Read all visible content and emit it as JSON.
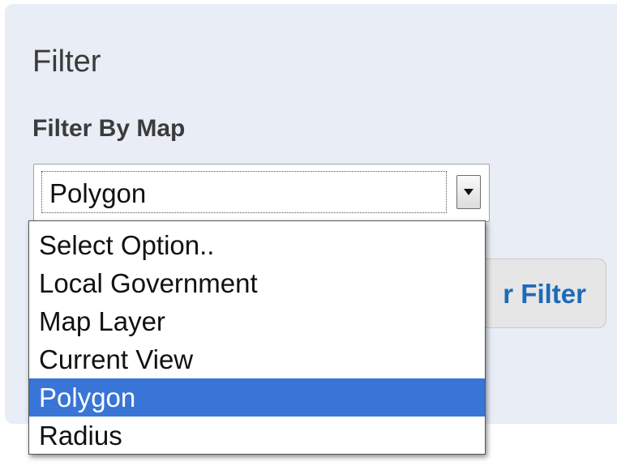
{
  "panel": {
    "title": "Filter"
  },
  "filter": {
    "label": "Filter By Map",
    "selected_value": "Polygon",
    "options": [
      {
        "label": "Select Option..",
        "selected": false
      },
      {
        "label": "Local Government",
        "selected": false
      },
      {
        "label": "Map Layer",
        "selected": false
      },
      {
        "label": "Current View",
        "selected": false
      },
      {
        "label": "Polygon",
        "selected": true
      },
      {
        "label": "Radius",
        "selected": false
      }
    ]
  },
  "button": {
    "visible_label": "r Filter"
  },
  "icons": {
    "select_arrow": "chevron-down-icon"
  },
  "colors": {
    "panel_bg": "#e8edf6",
    "highlight": "#3875d6",
    "button_text": "#1d6bb8"
  }
}
